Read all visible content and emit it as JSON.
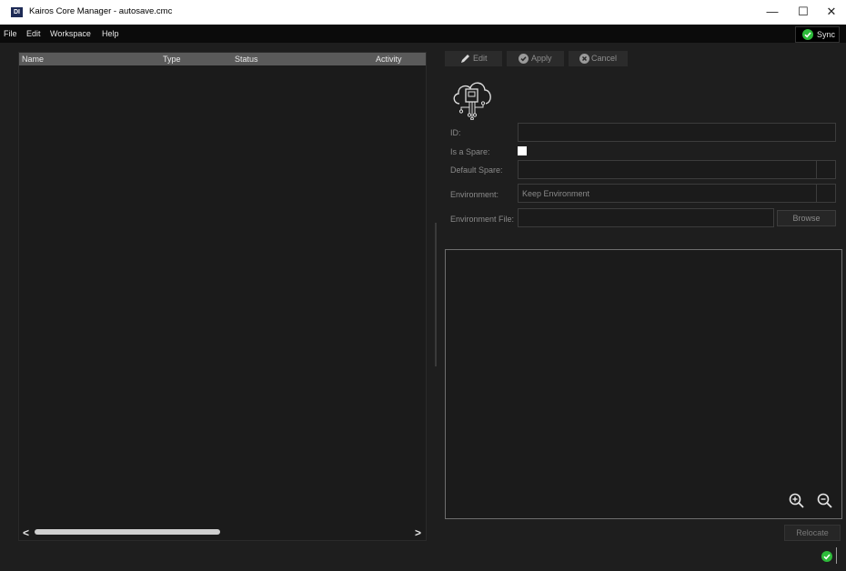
{
  "window": {
    "app_icon_text": "DI",
    "title": "Kairos Core Manager - autosave.cmc",
    "minimize_glyph": "—",
    "maximize_glyph": "☐",
    "close_glyph": "✕"
  },
  "menu": {
    "items": [
      {
        "label": "File"
      },
      {
        "label": "Edit"
      },
      {
        "label": "Workspace"
      },
      {
        "label": "Help"
      }
    ],
    "sync_label": "Sync"
  },
  "tree": {
    "columns": [
      {
        "label": "Name"
      },
      {
        "label": "Type"
      },
      {
        "label": "Status"
      },
      {
        "label": "Activity"
      }
    ],
    "rows": [],
    "scroll_left": "<",
    "scroll_right": ">"
  },
  "toolbar": {
    "edit_label": "Edit",
    "apply_label": "Apply",
    "cancel_label": "Cancel"
  },
  "form": {
    "id_label": "ID:",
    "id_value": "",
    "is_spare_label": "Is a Spare:",
    "is_spare_checked": false,
    "default_spare_label": "Default Spare:",
    "default_spare_value": "",
    "environment_label": "Environment:",
    "environment_value": "Keep Environment",
    "environment_file_label": "Environment File:",
    "environment_file_value": "",
    "browse_label": "Browse"
  },
  "viewer": {
    "relocate_label": "Relocate"
  },
  "colors": {
    "background": "#1e1e1e",
    "menubar": "#0b0b0b",
    "header": "#5a5a5a",
    "status_ok": "#2dbb3a"
  },
  "icons": [
    "app-icon",
    "pencil-icon",
    "check-circle-icon",
    "x-circle-icon",
    "cloud-device-icon",
    "zoom-in-icon",
    "zoom-out-icon",
    "status-ok-icon",
    "sync-check-icon"
  ]
}
